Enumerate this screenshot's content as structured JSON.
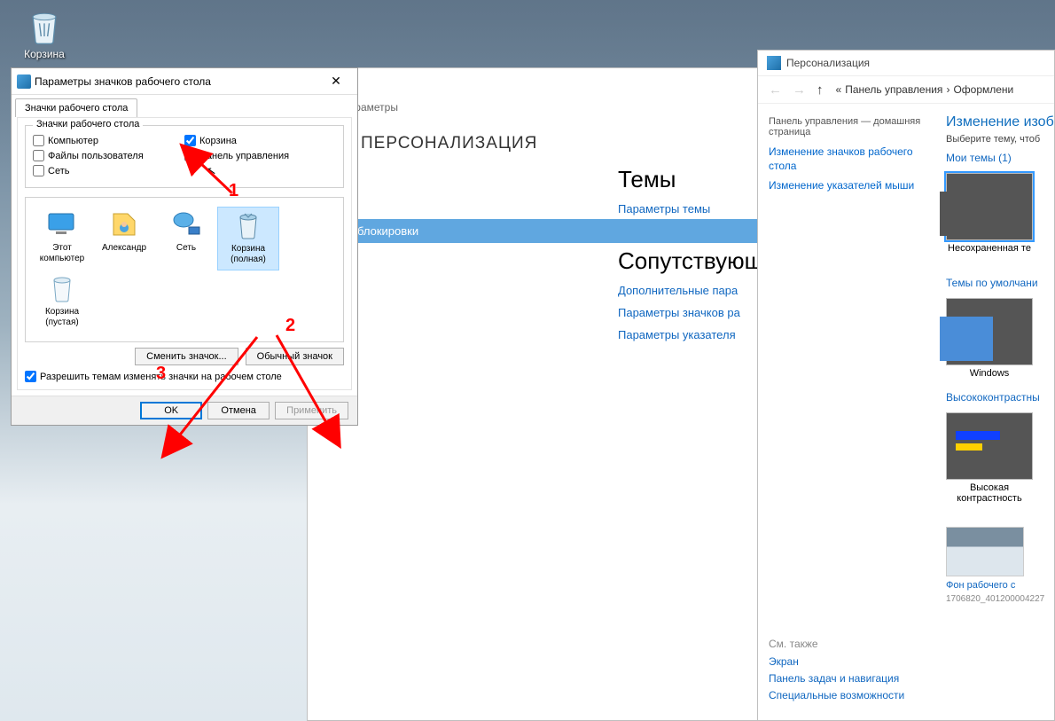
{
  "desktop": {
    "recycle_label": "Корзина"
  },
  "dialog": {
    "title": "Параметры значков рабочего стола",
    "tab": "Значки рабочего стола",
    "group_title": "Значки рабочего стола",
    "checks": {
      "computer": "Компьютер",
      "recycle": "Корзина",
      "userfiles": "Файлы пользователя",
      "cpanel": "Панель управления",
      "network": "Сеть"
    },
    "icons": [
      {
        "label": "Этот\nкомпьютер",
        "type": "pc"
      },
      {
        "label": "Александр",
        "type": "user"
      },
      {
        "label": "Сеть",
        "type": "net"
      },
      {
        "label": "Корзина\n(полная)",
        "type": "trash-full",
        "sel": true
      },
      {
        "label": "Корзина\n(пустая)",
        "type": "trash-empty"
      }
    ],
    "btn_change": "Сменить значок...",
    "btn_default": "Обычный значок",
    "allow_themes": "Разрешить темам изменять значки на рабочем столе",
    "ok": "OK",
    "cancel": "Отмена",
    "apply": "Применить"
  },
  "settings": {
    "breadcrumb": "Параметры",
    "heading": "ПЕРСОНАЛИЗАЦИЯ",
    "nav_item_selected": "блокировки",
    "r_themes": "Темы",
    "r_theme_params": "Параметры темы",
    "r_related": "Сопутствующи",
    "r_link1": "Дополнительные пара",
    "r_link2": "Параметры значков ра",
    "r_link3": "Параметры указателя"
  },
  "cp": {
    "title": "Персонализация",
    "bc1": "Панель управления",
    "bc2": "Оформлени",
    "left_head": "Панель управления — домашняя страница",
    "left_link1": "Изменение значков рабочего стола",
    "left_link2": "Изменение указателей мыши",
    "right_h": "Изменение изоб",
    "right_sub": "Выберите тему, чтоб",
    "sec_my": "Мои темы (1)",
    "theme1": "Несохраненная те",
    "sec_def": "Темы по умолчани",
    "theme2": "Windows",
    "sec_hc": "Высококонтрастны",
    "theme3": "Высокая\nконтрастность",
    "see_also": "См. также",
    "sa1": "Экран",
    "sa2": "Панель задач и навигация",
    "sa3": "Специальные возможности",
    "bg_link": "Фон рабочего с",
    "img_id": "1706820_401200004227"
  },
  "annotations": {
    "n1": "1",
    "n2": "2",
    "n3": "3"
  }
}
